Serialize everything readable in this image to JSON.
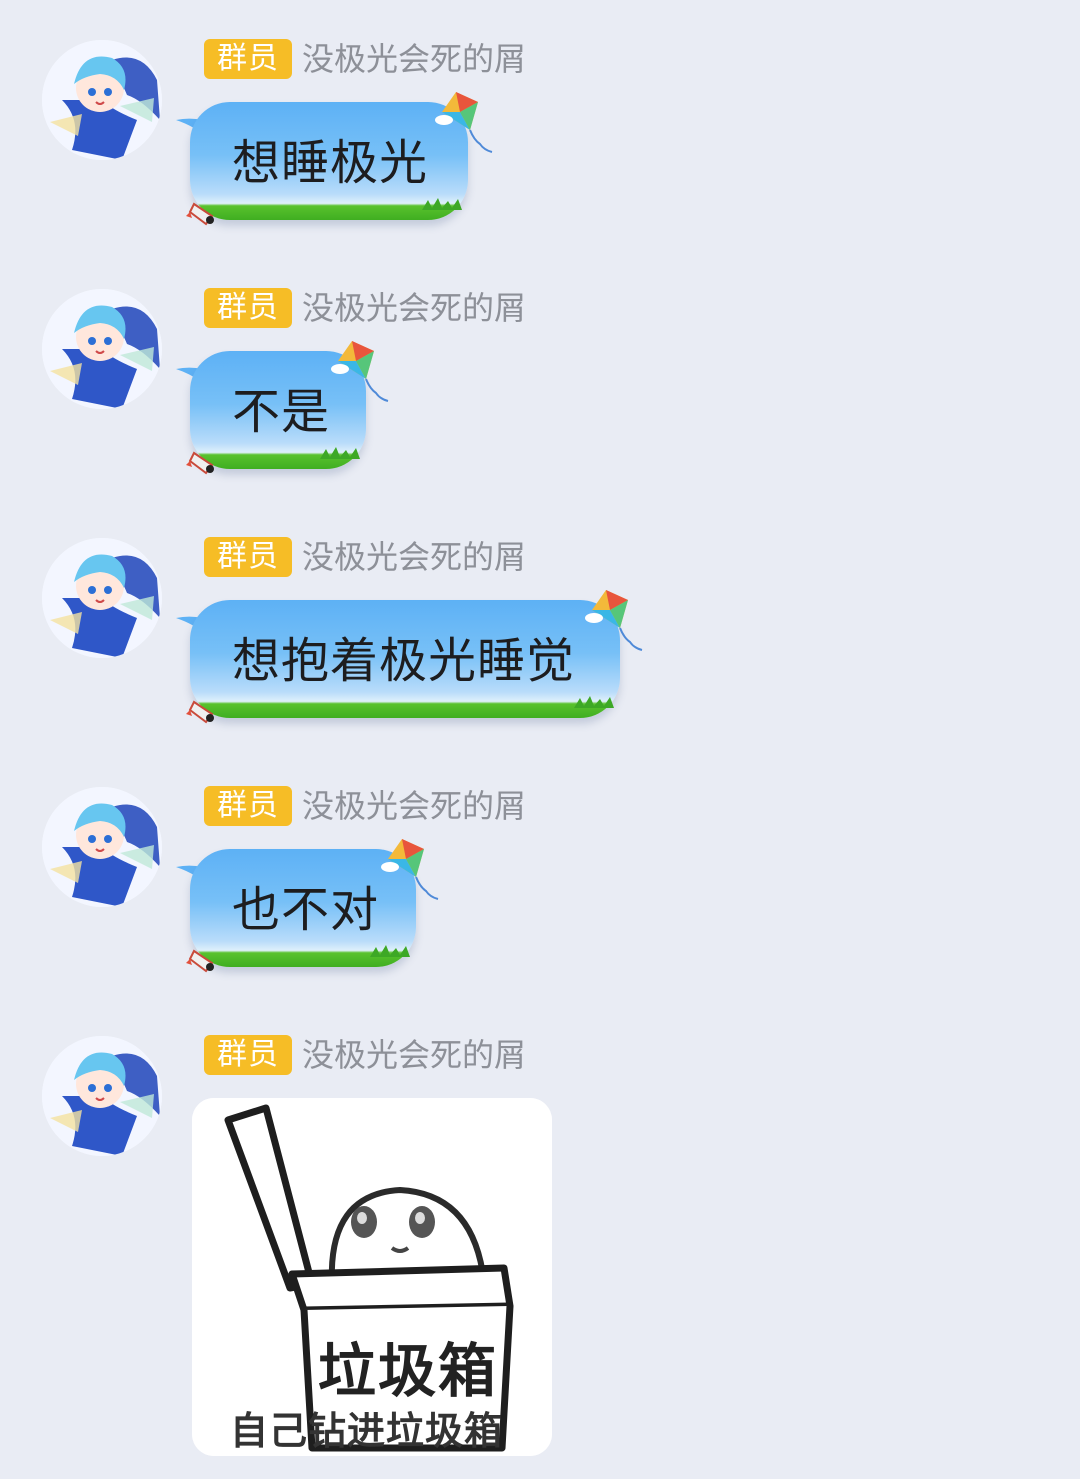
{
  "chat": {
    "messages": [
      {
        "badge": "群员",
        "nickname": "没极光会死的屑",
        "type": "text",
        "text": "想睡极光"
      },
      {
        "badge": "群员",
        "nickname": "没极光会死的屑",
        "type": "text",
        "text": "不是"
      },
      {
        "badge": "群员",
        "nickname": "没极光会死的屑",
        "type": "text",
        "text": "想抱着极光睡觉"
      },
      {
        "badge": "群员",
        "nickname": "没极光会死的屑",
        "type": "text",
        "text": "也不对"
      },
      {
        "badge": "群员",
        "nickname": "没极光会死的屑",
        "type": "sticker",
        "sticker_label": "垃圾箱",
        "sticker_caption": "自己钻进垃圾箱"
      }
    ]
  },
  "colors": {
    "background": "#e9ecf4",
    "badge": "#f6bd26",
    "nickname": "#8d9098",
    "bubble_top": "#5db1f5",
    "bubble_grass": "#3fae21"
  },
  "icons": {
    "avatar": "anime-girl-avatar",
    "bubble_decor": [
      "kite-icon",
      "rocket-icon",
      "grass-decoration"
    ]
  }
}
